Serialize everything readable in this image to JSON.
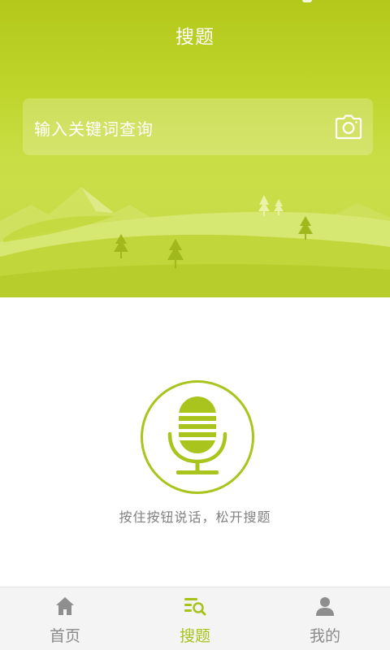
{
  "header": {
    "title": "搜题"
  },
  "search": {
    "placeholder": "输入关键词查询",
    "camera_icon": "camera-icon"
  },
  "voice": {
    "mic_icon": "microphone-icon",
    "hint": "按住按钮说话，松开搜题"
  },
  "tabs": [
    {
      "label": "首页",
      "icon": "home-icon",
      "active": false
    },
    {
      "label": "搜题",
      "icon": "search-list-icon",
      "active": true
    },
    {
      "label": "我的",
      "icon": "user-icon",
      "active": false
    }
  ],
  "colors": {
    "brand": "#b3c81a",
    "accent": "#a8c21c",
    "tab_inactive": "#8a8a8a",
    "hint_text": "#808080"
  }
}
